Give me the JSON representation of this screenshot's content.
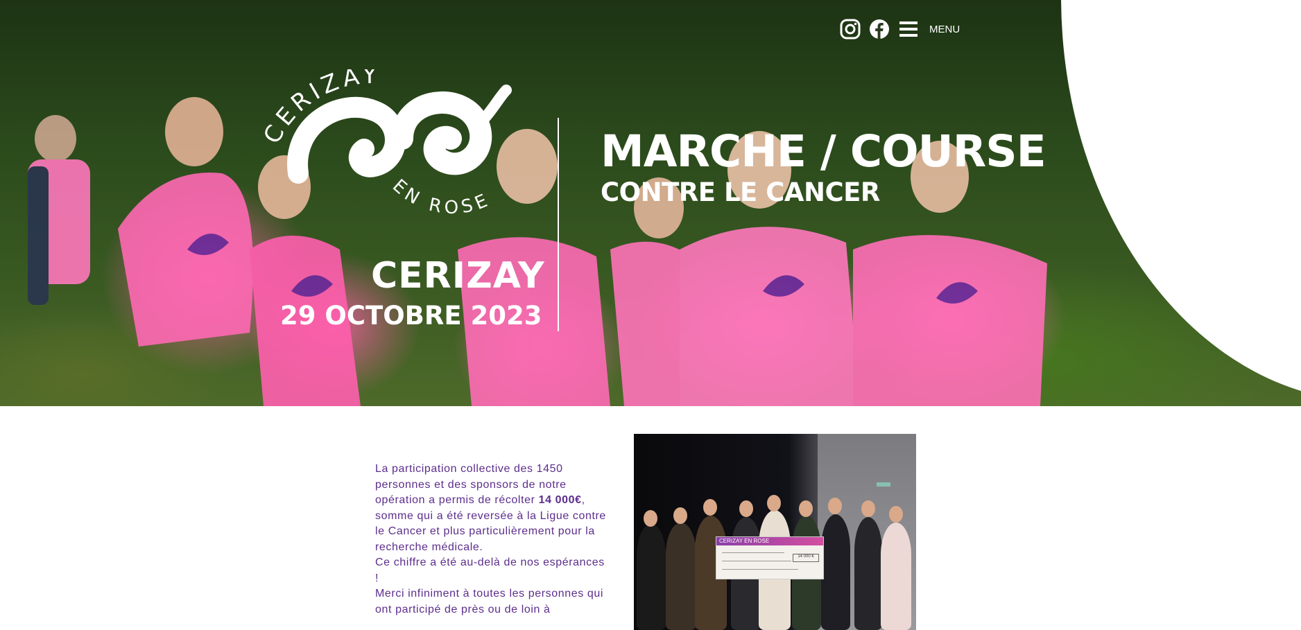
{
  "header": {
    "menu_label": "MENU",
    "icons": [
      "instagram-icon",
      "facebook-icon",
      "menu-icon"
    ]
  },
  "logo": {
    "top_text": "CERIZAY",
    "bottom_text": "EN ROSE"
  },
  "event": {
    "city": "CERIZAY",
    "date": "29 OCTOBRE 2023",
    "title": "MARCHE / COURSE",
    "subtitle": "CONTRE LE CANCER"
  },
  "content": {
    "p1_before": "La participation collective des 1450 personnes et des sponsors de notre opération a permis de récolter ",
    "p1_amount": "14 000€",
    "p1_after": ", somme qui a été reversée à la Ligue contre le Cancer et plus particulièrement pour la recherche médicale.",
    "p2": "Ce chiffre a été au-delà de nos espérances !",
    "p3": "Merci infiniment à toutes les personnes qui ont participé de près ou de loin à"
  },
  "photo": {
    "cheque_header": "CERIZAY EN ROSE",
    "cheque_amount": "14 000 €"
  },
  "colors": {
    "text_purple": "#5c2d8c",
    "brand_pink": "#ff69b4",
    "white": "#ffffff"
  }
}
